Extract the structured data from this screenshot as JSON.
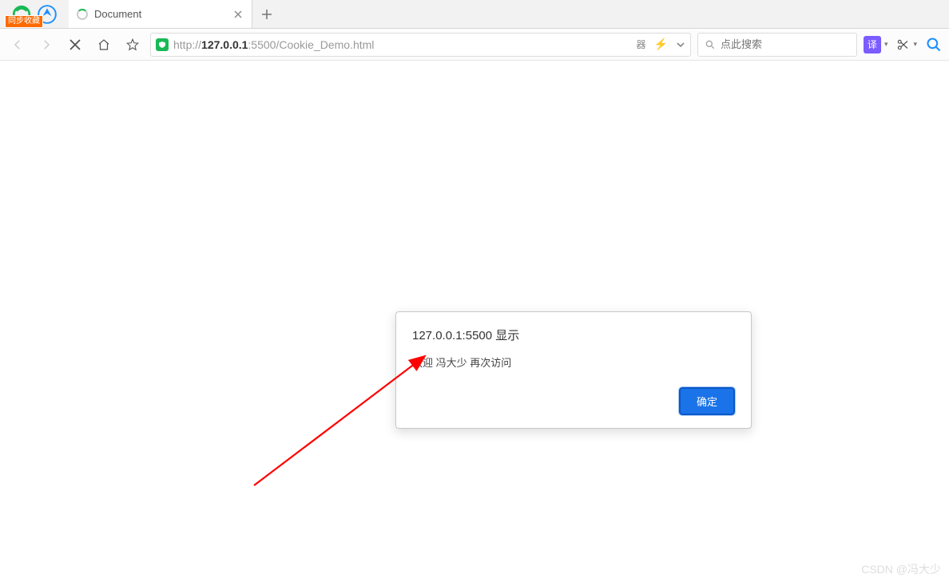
{
  "logo": {
    "sync_tag": "同步收藏"
  },
  "tab": {
    "title": "Document"
  },
  "address": {
    "protocol": "http://",
    "host": "127.0.0.1",
    "port": ":5500",
    "path": "/Cookie_Demo.html",
    "qr_label": "器"
  },
  "search": {
    "placeholder": "点此搜索"
  },
  "tools": {
    "translate": "译"
  },
  "dialog": {
    "title": "127.0.0.1:5500 显示",
    "message": "欢迎 冯大少 再次访问",
    "ok": "确定"
  },
  "watermark": "CSDN @冯大少"
}
